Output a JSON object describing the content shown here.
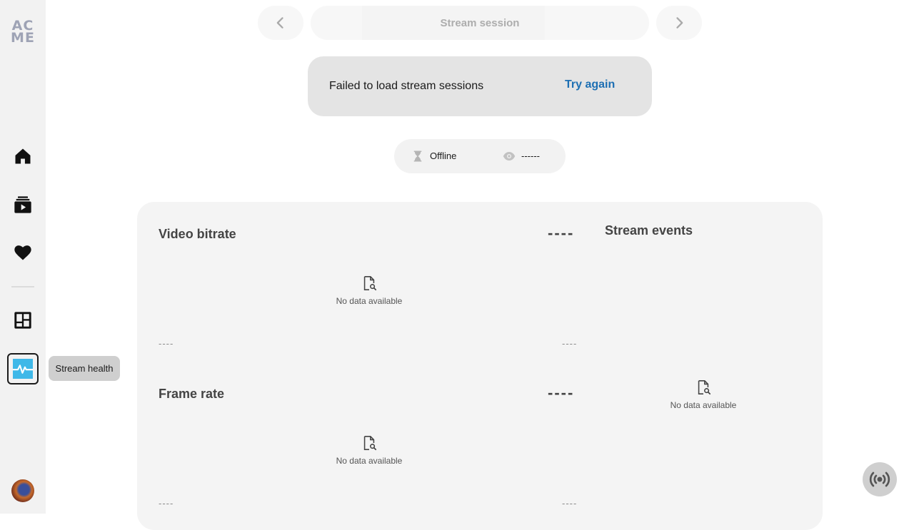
{
  "sidebar": {
    "logo_line1": "AC",
    "logo_line2": "ME",
    "items": [
      {
        "name": "home",
        "icon": "home-icon"
      },
      {
        "name": "videos",
        "icon": "video-library-icon"
      },
      {
        "name": "favorites",
        "icon": "heart-icon"
      },
      {
        "name": "dashboard",
        "icon": "dashboard-icon"
      },
      {
        "name": "stream-health",
        "icon": "pulse-icon",
        "active": true
      }
    ],
    "tooltip": "Stream health",
    "accent_color": "#3fb8e8"
  },
  "header": {
    "session_label": "Stream session"
  },
  "error": {
    "message": "Failed to load stream sessions",
    "action": "Try again"
  },
  "status": {
    "state": "Offline",
    "viewers": "------"
  },
  "panel": {
    "video_bitrate": {
      "title": "Video bitrate",
      "value": "----",
      "empty_text": "No data available",
      "x_start": "----",
      "x_end": "----"
    },
    "frame_rate": {
      "title": "Frame rate",
      "value": "----",
      "empty_text": "No data available",
      "x_start": "----",
      "x_end": "----"
    },
    "stream_events": {
      "title": "Stream events",
      "empty_text": "No data available"
    }
  },
  "fab": {
    "icon": "broadcast-icon"
  }
}
